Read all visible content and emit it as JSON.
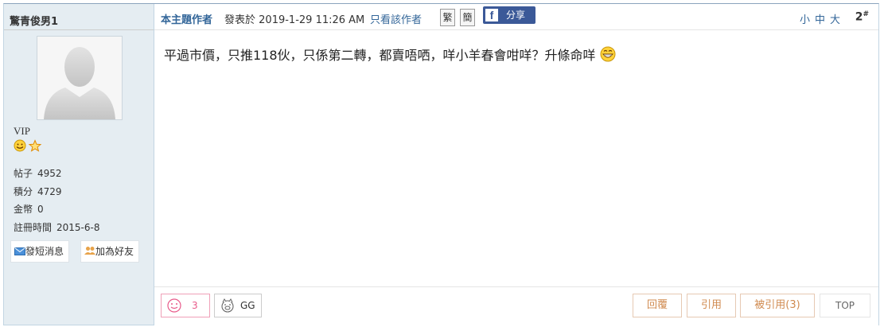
{
  "author": {
    "name": "驚青俊男1",
    "rank": "VIP"
  },
  "stats": [
    {
      "label": "帖子",
      "value": "4952"
    },
    {
      "label": "積分",
      "value": "4729"
    },
    {
      "label": "金幣",
      "value": "0"
    },
    {
      "label": "註冊時間",
      "value": "2015-6-8"
    }
  ],
  "side_buttons": {
    "message": "發短消息",
    "friend": "加為好友"
  },
  "post": {
    "author_label": "本主題作者",
    "time_prefix": "發表於",
    "time": "2019-1-29 11:26 AM",
    "only_author": "只看該作者",
    "trad": "繁",
    "simp": "簡",
    "share": "分享",
    "size_small": "小",
    "size_mid": "中",
    "size_large": "大",
    "floor": "2",
    "floor_mark": "#",
    "content": "平過市價，只推118伙，只係第二轉，都賣唔哂，咩小羊春會咁咩？升條命咩"
  },
  "rates": {
    "like_count": "3",
    "gg_label": "GG"
  },
  "actions": {
    "reply": "回覆",
    "quote": "引用",
    "quoted": "被引用(3)",
    "top": "TOP"
  },
  "colors": {
    "link": "#336699",
    "sidebar_bg": "#e5edf2",
    "action_text": "#d08a4f"
  }
}
